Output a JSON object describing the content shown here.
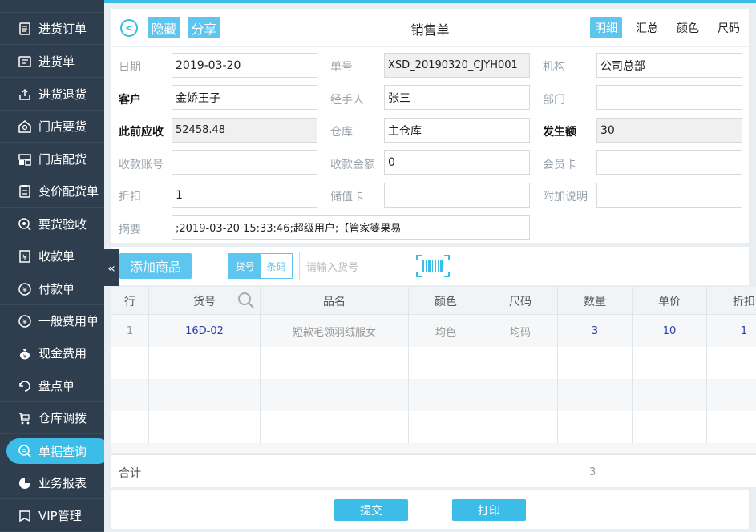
{
  "sidebar": {
    "items": [
      {
        "label": "进货订单",
        "icon": "purchase-order-icon"
      },
      {
        "label": "进货单",
        "icon": "purchase-icon"
      },
      {
        "label": "进货退货",
        "icon": "purchase-return-icon"
      },
      {
        "label": "门店要货",
        "icon": "store-request-icon"
      },
      {
        "label": "门店配货",
        "icon": "store-distribute-icon"
      },
      {
        "label": "变价配货单",
        "icon": "price-change-icon"
      },
      {
        "label": "要货验收",
        "icon": "inspect-icon"
      },
      {
        "label": "收款单",
        "icon": "receipt-icon"
      },
      {
        "label": "付款单",
        "icon": "payment-icon"
      },
      {
        "label": "一般费用单",
        "icon": "yen-icon"
      },
      {
        "label": "现金费用",
        "icon": "cash-bag-icon"
      },
      {
        "label": "盘点单",
        "icon": "stocktake-icon"
      },
      {
        "label": "仓库调拨",
        "icon": "cart-icon"
      },
      {
        "label": "单据查询",
        "icon": "search-doc-icon"
      },
      {
        "label": "业务报表",
        "icon": "pie-chart-icon"
      },
      {
        "label": "VIP管理",
        "icon": "vip-icon"
      }
    ]
  },
  "header": {
    "hide_label": "隐藏",
    "share_label": "分享",
    "title": "销售单",
    "view_tabs": [
      "明细",
      "汇总",
      "颜色",
      "尺码"
    ]
  },
  "form": {
    "date_label": "日期",
    "date_value": "2019-03-20",
    "docno_label": "单号",
    "docno_value": "XSD_20190320_CJYH001",
    "org_label": "机构",
    "org_value": "公司总部",
    "customer_label": "客户",
    "customer_value": "金娇王子",
    "handler_label": "经手人",
    "handler_value": "张三",
    "dept_label": "部门",
    "dept_value": "",
    "prev_recv_label": "此前应收",
    "prev_recv_value": "52458.48",
    "warehouse_label": "仓库",
    "warehouse_value": "主仓库",
    "amount_label": "发生额",
    "amount_value": "30",
    "account_label": "收款账号",
    "account_value": "",
    "recv_amount_label": "收款金额",
    "recv_amount_value": "0",
    "member_label": "会员卡",
    "member_value": "",
    "discount_label": "折扣",
    "discount_value": "1",
    "stored_label": "储值卡",
    "stored_value": "",
    "extra_label": "附加说明",
    "extra_value": "",
    "summary_label": "摘要",
    "summary_value": ";2019-03-20 15:33:46;超级用户;【管家婆果易"
  },
  "toolbar": {
    "add_label": "添加商品",
    "seg_sku": "货号",
    "seg_barcode": "条码",
    "sku_placeholder": "请输入货号"
  },
  "table": {
    "headers": [
      "行",
      "货号",
      "品名",
      "颜色",
      "尺码",
      "数量",
      "单价",
      "折扣"
    ],
    "rows": [
      {
        "line": "1",
        "sku": "16D-02",
        "name": "短款毛领羽绒服女",
        "color": "均色",
        "size": "均码",
        "qty": "3",
        "price": "10",
        "discount": "1"
      }
    ],
    "total_label": "合计",
    "total_qty": "3"
  },
  "actions": {
    "submit_label": "提交",
    "print_label": "打印"
  },
  "colors": {
    "accent": "#3bbde8",
    "sidebar": "#2e3e4e"
  }
}
